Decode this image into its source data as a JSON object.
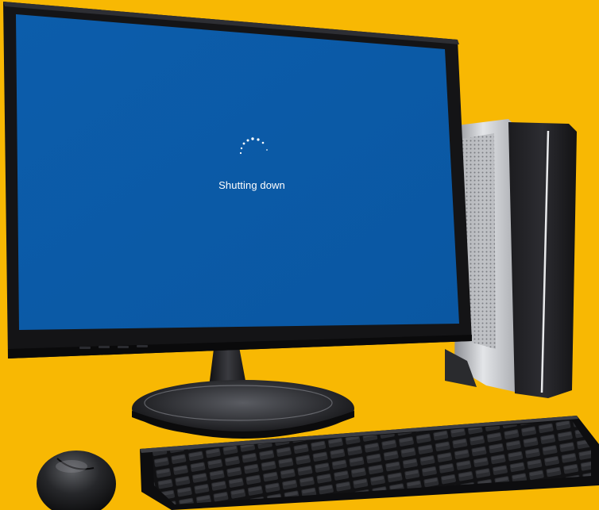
{
  "screen": {
    "status_text": "Shutting down",
    "spinner_icon": "loading-dots-icon"
  },
  "colors": {
    "background": "#F8B803",
    "screen": "#0A5AA7",
    "bezel": "#141416",
    "text": "#FFFFFF"
  }
}
